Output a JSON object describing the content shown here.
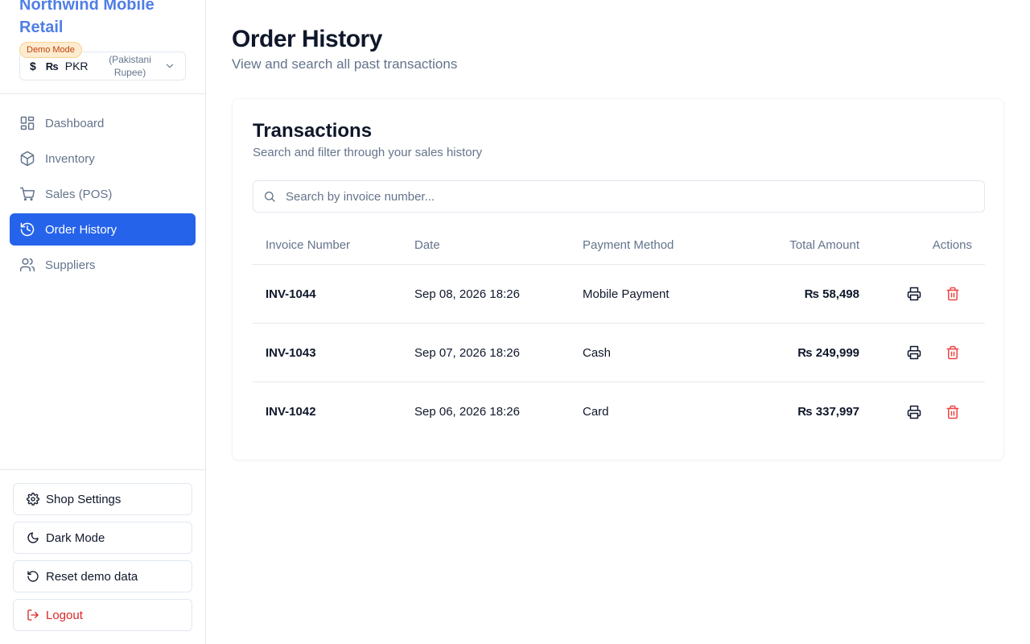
{
  "sidebar": {
    "brand": "Northwind Mobile Retail",
    "demo_badge": "Demo Mode",
    "currency": {
      "dollar_glyph": "$",
      "symbol": "₨",
      "code": "PKR",
      "name": "(Pakistani Rupee)"
    },
    "nav": [
      {
        "label": "Dashboard",
        "icon": "dashboard-icon",
        "active": false
      },
      {
        "label": "Inventory",
        "icon": "package-icon",
        "active": false
      },
      {
        "label": "Sales (POS)",
        "icon": "shopping-cart-icon",
        "active": false
      },
      {
        "label": "Order History",
        "icon": "history-icon",
        "active": true
      },
      {
        "label": "Suppliers",
        "icon": "users-icon",
        "active": false
      }
    ],
    "bottom": {
      "settings": "Shop Settings",
      "dark_mode": "Dark Mode",
      "reset": "Reset demo data",
      "logout": "Logout"
    }
  },
  "header": {
    "title": "Order History",
    "subtitle": "View and search all past transactions"
  },
  "card": {
    "title": "Transactions",
    "subtitle": "Search and filter through your sales history",
    "search_placeholder": "Search by invoice number..."
  },
  "table": {
    "columns": [
      "Invoice Number",
      "Date",
      "Payment Method",
      "Total Amount",
      "Actions"
    ],
    "rows": [
      {
        "invoice": "INV-1044",
        "date": "Sep 08, 2026 18:26",
        "method": "Mobile Payment",
        "total": "₨ 58,498"
      },
      {
        "invoice": "INV-1043",
        "date": "Sep 07, 2026 18:26",
        "method": "Cash",
        "total": "₨ 249,999"
      },
      {
        "invoice": "INV-1042",
        "date": "Sep 06, 2026 18:26",
        "method": "Card",
        "total": "₨ 337,997"
      }
    ]
  },
  "colors": {
    "accent": "#2563eb",
    "brand": "#4f7fe6",
    "danger": "#dc2626",
    "muted": "#64748b"
  }
}
